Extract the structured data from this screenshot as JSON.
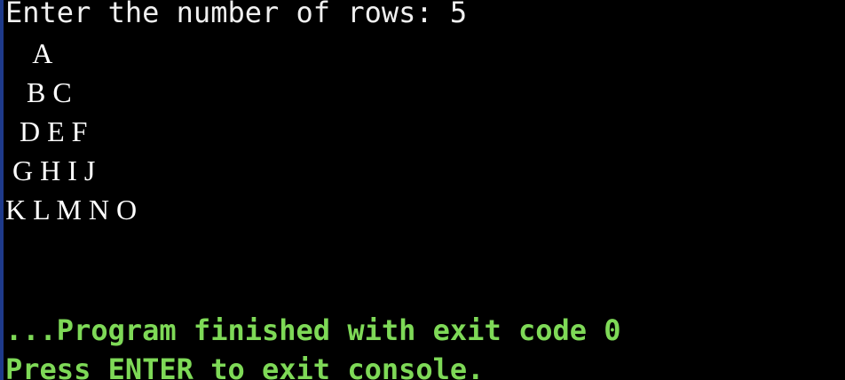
{
  "console": {
    "prompt": "Enter the number of rows: 5",
    "pattern_rows": [
      "    A",
      "   B C",
      "  D E F",
      " G H I J",
      "K L M N O"
    ],
    "finish_message": "...Program finished with exit code 0",
    "exit_message": "Press ENTER to exit console.",
    "colors": {
      "background": "#000000",
      "text": "#f0f0f0",
      "status": "#7ed957"
    }
  }
}
